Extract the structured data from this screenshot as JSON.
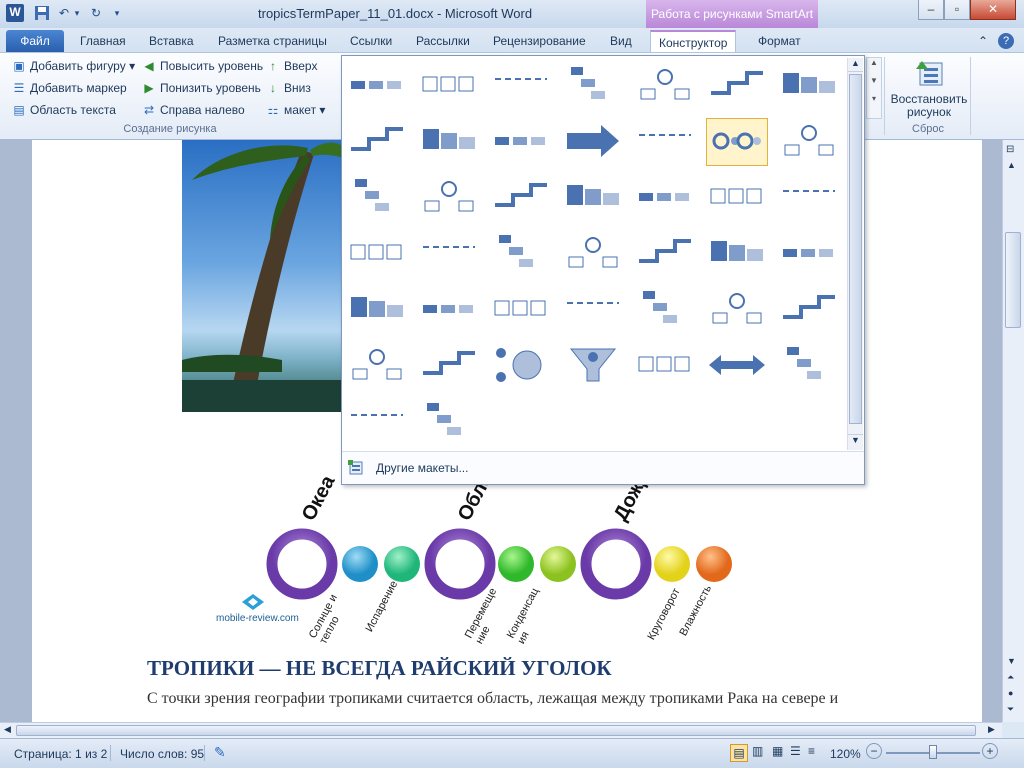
{
  "window": {
    "title": "tropicsTermPaper_11_01.docx  -  Microsoft Word",
    "context_tab": "Работа с рисунками SmartArt",
    "app_icon": "word-icon"
  },
  "tabs": [
    "Файл",
    "Главная",
    "Вставка",
    "Разметка страницы",
    "Ссылки",
    "Рассылки",
    "Рецензирование",
    "Вид",
    "Конструктор",
    "Формат"
  ],
  "ribbon": {
    "create_group": {
      "add_shape": "Добавить фигуру",
      "add_bullet": "Добавить маркер",
      "text_pane": "Область текста",
      "promote": "Повысить уровень",
      "demote": "Понизить уровень",
      "rtl": "Справа налево",
      "up": "Вверх",
      "down": "Вниз",
      "layout": "макет",
      "label": "Создание рисунка"
    },
    "reset_group": {
      "reset_line1": "Восстановить",
      "reset_line2": "рисунок",
      "label": "Сброс"
    }
  },
  "gallery": {
    "more_layouts": "Другие макеты...",
    "selected_index": 12
  },
  "document": {
    "smartart_big": [
      "Океа",
      "Обла",
      "Дожд"
    ],
    "smartart_small": [
      "Солнце и тепло",
      "Испарение",
      "Перемеще ние",
      "Конденсац ия",
      "Круговорот",
      "Влажность"
    ],
    "watermark": "mobile-review.com",
    "heading": "ТРОПИКИ — НЕ ВСЕГДА РАЙСКИЙ УГОЛОК",
    "paragraph": "С точки зрения географии тропиками считается область, лежащая между тропиками Рака на севере и"
  },
  "status": {
    "page": "Страница: 1 из 2",
    "words": "Число слов: 95",
    "zoom": "120%"
  }
}
